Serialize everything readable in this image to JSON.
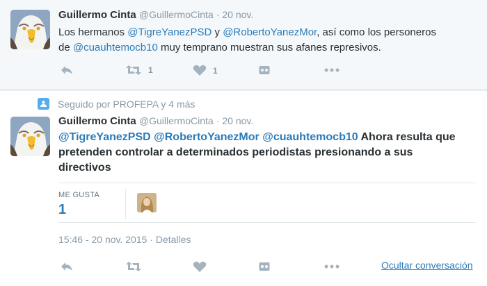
{
  "tweet1": {
    "author_name": "Guillermo Cinta",
    "author_handle": "@GuillermoCinta",
    "date": "· 20 nov.",
    "text_parts": [
      "Los hermanos ",
      "@TigreYanezPSD",
      " y ",
      "@RobertoYanezMor",
      ", así como los personeros",
      "de ",
      "@cuauhtemocb10",
      " muy temprano muestran sus afanes represivos."
    ],
    "retweet_count": "1",
    "like_count": "1"
  },
  "context": {
    "followed_by": "Seguido por PROFEPA y 4 más"
  },
  "tweet2": {
    "author_name": "Guillermo Cinta",
    "author_handle": "@GuillermoCinta",
    "date": "· 20 nov.",
    "text_parts": [
      "@TigreYanezPSD",
      " ",
      "@RobertoYanezMor",
      " ",
      "@cuauhtemocb10",
      " Ahora resulta que",
      "pretenden controlar a determinados periodistas presionando a sus",
      "directivos"
    ],
    "likes_label": "ME GUSTA",
    "likes_value": "1",
    "timestamp": "15:46 - 20 nov. 2015 · Detalles",
    "hide_conversation": "Ocultar conversación"
  },
  "icons": [
    "reply-icon",
    "retweet-icon",
    "heart-icon",
    "overflow-icon",
    "more-icon",
    "follow-card-icon"
  ],
  "colors": {
    "link": "#2b7bb9",
    "muted": "#8899a6",
    "text": "#292f33",
    "followed_icon": "#55acee"
  }
}
